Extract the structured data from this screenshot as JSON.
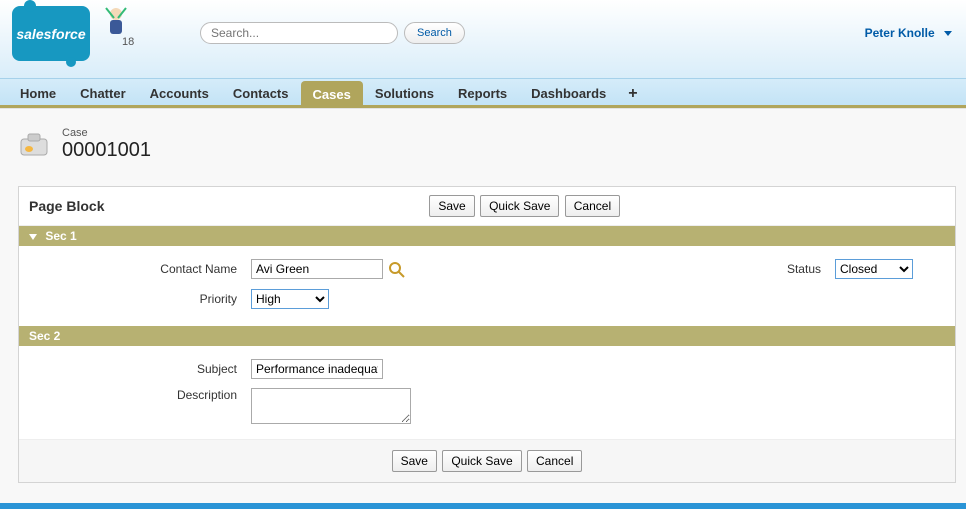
{
  "brand": "salesforce",
  "mascot_badge": "18",
  "search": {
    "placeholder": "Search...",
    "button": "Search"
  },
  "user": {
    "name": "Peter Knolle"
  },
  "tabs": [
    "Home",
    "Chatter",
    "Accounts",
    "Contacts",
    "Cases",
    "Solutions",
    "Reports",
    "Dashboards"
  ],
  "active_tab": "Cases",
  "record": {
    "type": "Case",
    "title": "00001001"
  },
  "page_block": {
    "title": "Page Block",
    "buttons": {
      "save": "Save",
      "quick_save": "Quick Save",
      "cancel": "Cancel"
    },
    "sections": [
      {
        "title": "Sec 1",
        "collapsible": true,
        "fields": {
          "contact_name": {
            "label": "Contact Name",
            "value": "Avi Green"
          },
          "status": {
            "label": "Status",
            "value": "Closed"
          },
          "priority": {
            "label": "Priority",
            "value": "High"
          }
        }
      },
      {
        "title": "Sec 2",
        "collapsible": false,
        "fields": {
          "subject": {
            "label": "Subject",
            "value": "Performance inadequate"
          },
          "description": {
            "label": "Description",
            "value": ""
          }
        }
      }
    ]
  }
}
